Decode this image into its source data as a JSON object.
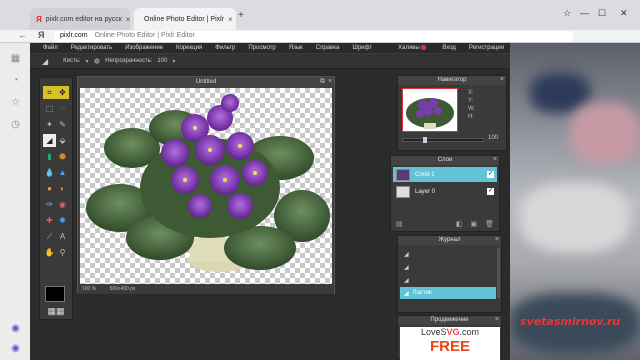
{
  "browser": {
    "tabs": [
      {
        "label": "pixlr.com editor на русск",
        "active": false
      },
      {
        "label": "Online Photo Editor | Pixlr",
        "active": true
      }
    ],
    "address_host": "pixlr.com",
    "address_title": "Online Photo Editor | Pixlr Editor"
  },
  "menu": {
    "items": [
      "Файл",
      "Редактировать",
      "Изображение",
      "Корекция",
      "Фильтр",
      "Просмотр",
      "Язык",
      "Справка",
      "Шрифт",
      "Халявы"
    ],
    "right": [
      "Вход",
      "Регистрация"
    ]
  },
  "options": {
    "brush_label": "Кисть:",
    "opacity_label": "Непрозрачность:",
    "opacity_value": "100"
  },
  "document": {
    "title": "Untitled",
    "zoom": "100 %",
    "size": "500x400 px"
  },
  "navigator": {
    "title": "Навигатор",
    "x_label": "X:",
    "y_label": "Y:",
    "w_label": "W:",
    "h_label": "H:",
    "zoom": "100"
  },
  "layers": {
    "title": "Слои",
    "items": [
      {
        "name": "Слой 1",
        "selected": true
      },
      {
        "name": "Layer 0",
        "selected": false
      }
    ]
  },
  "history": {
    "title": "Журнал",
    "items": [
      "",
      "",
      "",
      "Ластик"
    ]
  },
  "promo": {
    "title": "Продвижение",
    "logo_a": "LoveS",
    "logo_b": "VG",
    "logo_c": ".com",
    "free": "FREE"
  },
  "watermark": "svetasmirnov.ru",
  "colors": {
    "accent": "#62c3d6",
    "active_tool": "#d7c12a",
    "app_bg": "#2b2b2b"
  }
}
